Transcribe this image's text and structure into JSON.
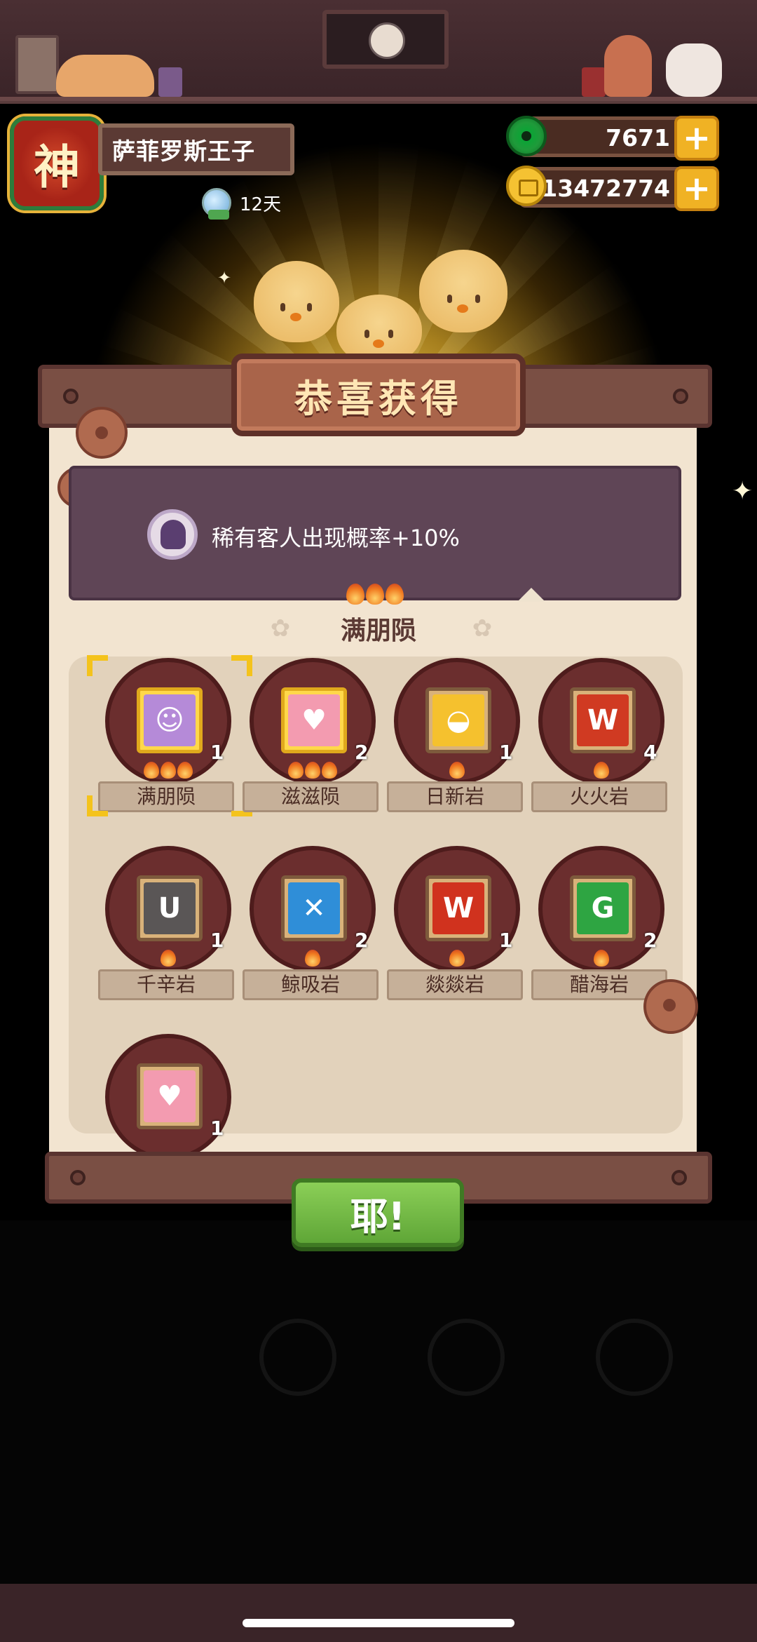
{
  "player": {
    "avatar_char": "神",
    "name": "萨菲罗斯王子",
    "days": "12天"
  },
  "currency": {
    "jade": "7671",
    "coins": "13472774",
    "plus": "+"
  },
  "dialog": {
    "title": "恭喜获得",
    "bonus_text": "稀有客人出现概率+10%",
    "selected_name": "满朋陨",
    "confirm_label": "耶!"
  },
  "items": [
    {
      "name": "满朋陨",
      "count": "1",
      "flames": 3,
      "color": "#b58ad8",
      "glyph": "☺",
      "gold": true,
      "selected": true
    },
    {
      "name": "滋滋陨",
      "count": "2",
      "flames": 3,
      "color": "#f39bb0",
      "glyph": "♥",
      "gold": true,
      "selected": false
    },
    {
      "name": "日新岩",
      "count": "1",
      "flames": 1,
      "color": "#f5c12e",
      "glyph": "◒",
      "gold": false,
      "selected": false
    },
    {
      "name": "火火岩",
      "count": "4",
      "flames": 1,
      "color": "#d03a22",
      "glyph": "W",
      "gold": false,
      "selected": false
    },
    {
      "name": "千辛岩",
      "count": "1",
      "flames": 1,
      "color": "#5a5656",
      "glyph": "U",
      "gold": false,
      "selected": false
    },
    {
      "name": "鲸吸岩",
      "count": "2",
      "flames": 1,
      "color": "#2f8ed8",
      "glyph": "✕",
      "gold": false,
      "selected": false
    },
    {
      "name": "燚燚岩",
      "count": "1",
      "flames": 1,
      "color": "#d0321e",
      "glyph": "W",
      "gold": false,
      "selected": false
    },
    {
      "name": "醋海岩",
      "count": "2",
      "flames": 1,
      "color": "#2ea542",
      "glyph": "G",
      "gold": false,
      "selected": false
    },
    {
      "name": "",
      "count": "1",
      "flames": 0,
      "color": "#f39bb0",
      "glyph": "♥",
      "gold": false,
      "selected": false
    }
  ]
}
